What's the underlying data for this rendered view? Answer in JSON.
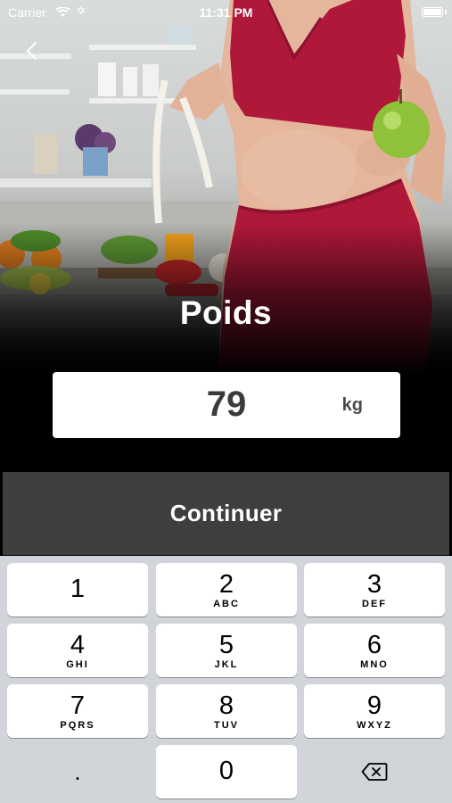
{
  "status_bar": {
    "carrier": "Carrier",
    "time": "11:31 PM"
  },
  "nav": {
    "back_icon": "chevron-left-icon"
  },
  "title": "Poids",
  "weight_input": {
    "value": "79",
    "unit": "kg"
  },
  "continue_label": "Continuer",
  "keypad": {
    "keys": [
      {
        "digit": "1",
        "letters": ""
      },
      {
        "digit": "2",
        "letters": "ABC"
      },
      {
        "digit": "3",
        "letters": "DEF"
      },
      {
        "digit": "4",
        "letters": "GHI"
      },
      {
        "digit": "5",
        "letters": "JKL"
      },
      {
        "digit": "6",
        "letters": "MNO"
      },
      {
        "digit": "7",
        "letters": "PQRS"
      },
      {
        "digit": "8",
        "letters": "TUV"
      },
      {
        "digit": "9",
        "letters": "WXYZ"
      },
      {
        "digit": "0",
        "letters": ""
      }
    ],
    "decimal": ".",
    "delete_icon": "backspace-icon"
  },
  "colors": {
    "background": "#000000",
    "button": "#3e3e3e",
    "accent": "#b0183a",
    "keypad": "#d1d4d9"
  }
}
